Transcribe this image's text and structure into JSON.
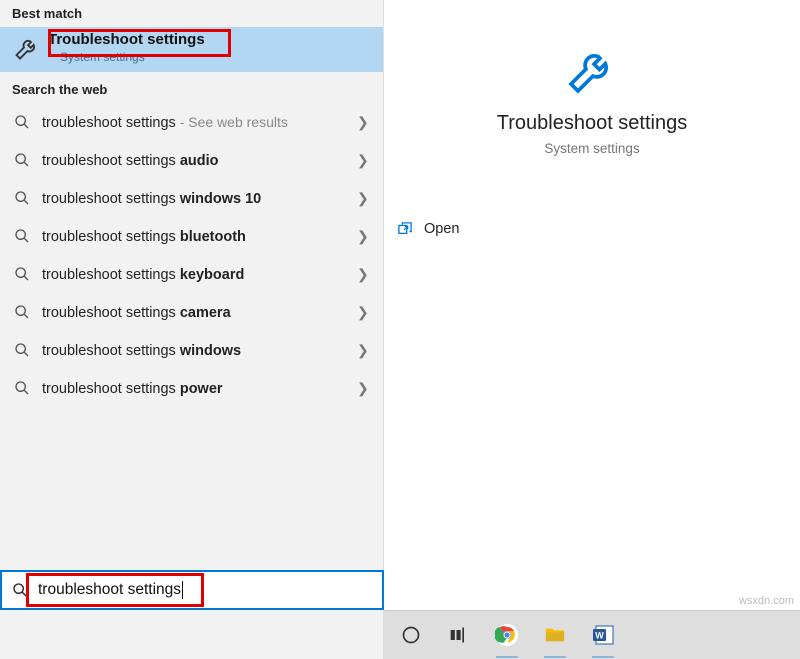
{
  "left": {
    "best_match_header": "Best match",
    "best_item": {
      "title": "Troubleshoot settings",
      "subtitle": "System settings"
    },
    "web_header": "Search the web",
    "items": [
      {
        "prefix": "troubleshoot settings",
        "suffix": "",
        "see": " - See web results"
      },
      {
        "prefix": "troubleshoot settings ",
        "suffix": "audio",
        "see": ""
      },
      {
        "prefix": "troubleshoot settings ",
        "suffix": "windows 10",
        "see": ""
      },
      {
        "prefix": "troubleshoot settings ",
        "suffix": "bluetooth",
        "see": ""
      },
      {
        "prefix": "troubleshoot settings ",
        "suffix": "keyboard",
        "see": ""
      },
      {
        "prefix": "troubleshoot settings ",
        "suffix": "camera",
        "see": ""
      },
      {
        "prefix": "troubleshoot settings ",
        "suffix": "windows",
        "see": ""
      },
      {
        "prefix": "troubleshoot settings ",
        "suffix": "power",
        "see": ""
      }
    ],
    "search_value": "troubleshoot settings"
  },
  "right": {
    "title": "Troubleshoot settings",
    "subtitle": "System settings",
    "open_label": "Open"
  },
  "watermark": "wsxdn.com"
}
